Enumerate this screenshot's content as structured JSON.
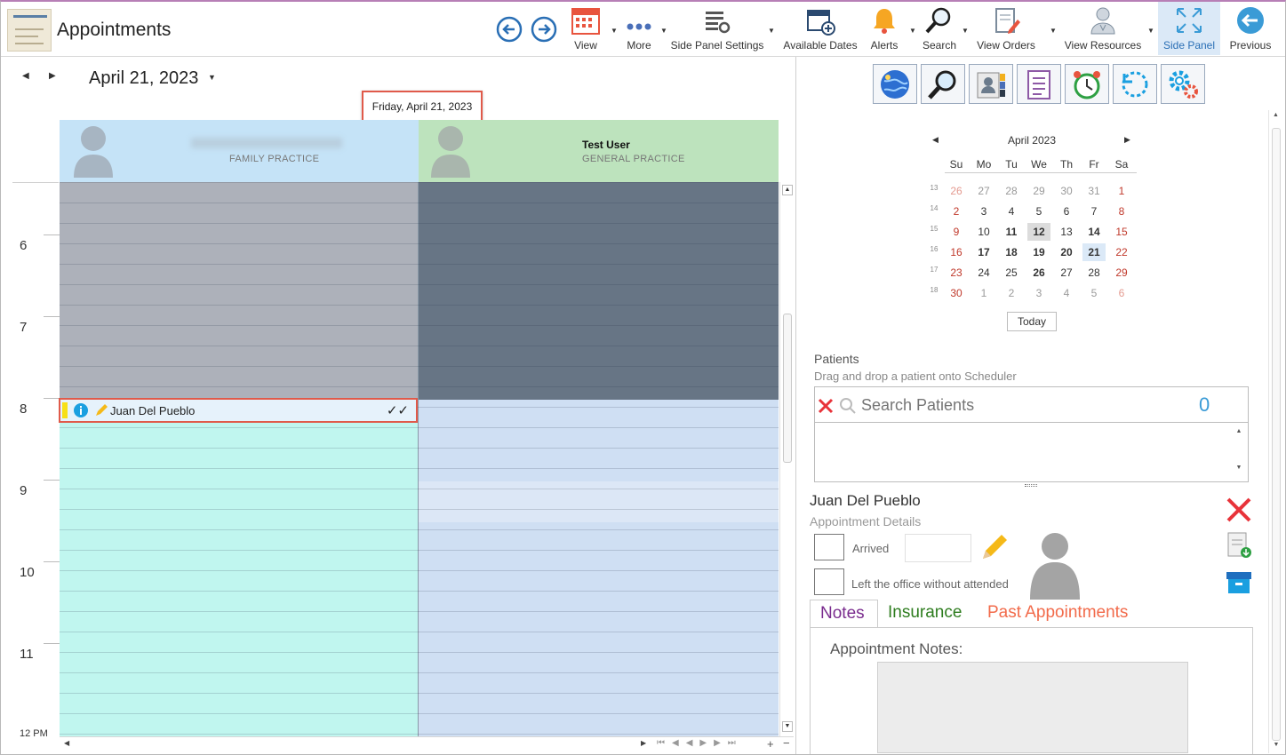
{
  "app": {
    "title": "Appointments"
  },
  "toolbar": {
    "view": "View",
    "more": "More",
    "side_panel_settings": "Side Panel Settings",
    "available_dates": "Available Dates",
    "alerts": "Alerts",
    "search": "Search",
    "view_orders": "View Orders",
    "view_resources": "View Resources",
    "side_panel": "Side Panel",
    "previous": "Previous"
  },
  "scheduler": {
    "date_label": "April 21, 2023",
    "date_tooltip": "Friday, April 21, 2023",
    "hours": [
      "6",
      "7",
      "8",
      "9",
      "10",
      "11",
      "12 PM"
    ],
    "resources": [
      {
        "name": "",
        "specialty": "FAMILY PRACTICE"
      },
      {
        "name": "Test User",
        "specialty": "GENERAL PRACTICE"
      }
    ],
    "appointment": {
      "patient": "Juan Del Pueblo",
      "status": "✓✓"
    }
  },
  "calendar": {
    "month_label": "April 2023",
    "weekdays": [
      "Su",
      "Mo",
      "Tu",
      "We",
      "Th",
      "Fr",
      "Sa"
    ],
    "weeks": [
      {
        "num": "13",
        "days": [
          "26",
          "27",
          "28",
          "29",
          "30",
          "31",
          "1"
        ]
      },
      {
        "num": "14",
        "days": [
          "2",
          "3",
          "4",
          "5",
          "6",
          "7",
          "8"
        ]
      },
      {
        "num": "15",
        "days": [
          "9",
          "10",
          "11",
          "12",
          "13",
          "14",
          "15"
        ]
      },
      {
        "num": "16",
        "days": [
          "16",
          "17",
          "18",
          "19",
          "20",
          "21",
          "22"
        ]
      },
      {
        "num": "17",
        "days": [
          "23",
          "24",
          "25",
          "26",
          "27",
          "28",
          "29"
        ]
      },
      {
        "num": "18",
        "days": [
          "30",
          "1",
          "2",
          "3",
          "4",
          "5",
          "6"
        ]
      }
    ],
    "today_button": "Today"
  },
  "patients": {
    "title": "Patients",
    "subtitle": "Drag and drop a patient onto Scheduler",
    "search_placeholder": "Search Patients",
    "count": "0"
  },
  "details": {
    "patient_name": "Juan Del Pueblo",
    "subtitle": "Appointment Details",
    "arrived_label": "Arrived",
    "left_label": "Left the office without attended",
    "tabs": {
      "notes": "Notes",
      "insurance": "Insurance",
      "past": "Past Appointments"
    },
    "notes_label": "Appointment Notes:"
  },
  "colors": {
    "accent": "#2a6fb5",
    "sunday": "#c0392b",
    "tooltip_border": "#e05a4a",
    "resource1_header": "#c5e3f7",
    "resource2_header": "#bde3bd",
    "offhours1": "#adb1ba",
    "offhours2": "#677585",
    "work1": "#c0f6ef",
    "work2": "#cfdff3"
  }
}
